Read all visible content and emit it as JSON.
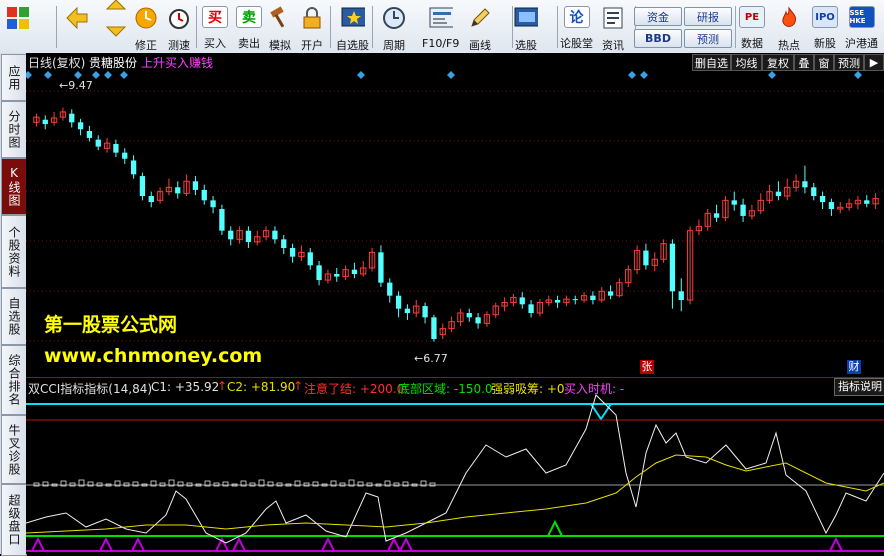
{
  "toolbar": {
    "items": [
      {
        "label": "",
        "icon": "windows-logo-icon"
      },
      {
        "label": "",
        "icon": "back-arrow-icon"
      },
      {
        "label": "",
        "icon": "up-down-arrows-icon"
      },
      {
        "label": "修正",
        "icon": "clock-refresh-icon"
      },
      {
        "label": "测速",
        "icon": "stopwatch-icon"
      },
      {
        "label": "买入",
        "icon_text": "买"
      },
      {
        "label": "卖出",
        "icon_text": "卖"
      },
      {
        "label": "模拟",
        "icon": "hammer-icon"
      },
      {
        "label": "开户",
        "icon": "lock-icon"
      },
      {
        "label": "自选股",
        "icon": "star-screen-icon"
      },
      {
        "label": "周期",
        "icon": "clock-period-icon"
      },
      {
        "label": "F10/F9",
        "icon": "document-icon"
      },
      {
        "label": "画线",
        "icon": "pencil-icon"
      },
      {
        "label": "选股",
        "icon": "screen-select-icon"
      },
      {
        "label": "论股堂",
        "icon_text": "论"
      },
      {
        "label": "资讯",
        "icon": "news-icon"
      },
      {
        "label": "数据",
        "icon_text": "PE"
      },
      {
        "label": "热点",
        "icon": "fire-icon"
      },
      {
        "label": "新股",
        "icon_text": "IPO"
      },
      {
        "label": "沪港通",
        "icon_text": "SSE HKE"
      }
    ],
    "pills": [
      "资金",
      "BBD",
      "研报",
      "预测"
    ]
  },
  "left_tabs": [
    "应用",
    "分时图",
    "K线图",
    "个股资料",
    "自选股",
    "综合排名",
    "牛叉诊股",
    "超级盘口"
  ],
  "header": {
    "period": "日线(复权)",
    "stock_name": "贵糖股份",
    "signal": "上升买入赚钱",
    "right_buttons": [
      "删自选",
      "均线",
      "复权",
      "叠",
      "窗",
      "预测"
    ],
    "right_arrow": "▶"
  },
  "price_labels": {
    "high": "←9.47",
    "low": "←6.77"
  },
  "markers": {
    "zhang": "张",
    "cai": "财"
  },
  "watermark": {
    "line1": "第一股票公式网",
    "line2": "www.chnmoney.com"
  },
  "indicator": {
    "name": "双CCI指标指标(14,84)",
    "c1": "C1: +35.92",
    "c2": "C2: +81.90",
    "warn": "注意了结: +200.0",
    "bottom": "底部区域: -150.0",
    "strong": "强弱吸筹: +0",
    "buy": "买入时机: -",
    "explain_button": "指标说明"
  },
  "colors": {
    "up": "#ff3c3c",
    "down": "#54ffff",
    "diamond": "#3aa0e0",
    "cyan_line": "#00e0ff",
    "red_line": "#c01010",
    "yellow_line": "#e8e000",
    "green_line": "#00e000",
    "purple_line": "#c000d0"
  },
  "chart_data": {
    "type": "candlestick",
    "series_note": "",
    "y_range": [
      6.5,
      9.8
    ],
    "candles": [
      [
        9.3,
        9.36,
        9.4,
        9.25
      ],
      [
        9.33,
        9.28,
        9.38,
        9.22
      ],
      [
        9.3,
        9.35,
        9.42,
        9.26
      ],
      [
        9.36,
        9.42,
        9.47,
        9.32
      ],
      [
        9.4,
        9.3,
        9.45,
        9.24
      ],
      [
        9.3,
        9.22,
        9.34,
        9.15
      ],
      [
        9.2,
        9.12,
        9.26,
        9.08
      ],
      [
        9.1,
        9.02,
        9.15,
        8.98
      ],
      [
        9.0,
        9.06,
        9.12,
        8.95
      ],
      [
        9.05,
        8.95,
        9.1,
        8.9
      ],
      [
        8.95,
        8.88,
        9.0,
        8.82
      ],
      [
        8.86,
        8.7,
        8.92,
        8.65
      ],
      [
        8.68,
        8.45,
        8.72,
        8.4
      ],
      [
        8.45,
        8.38,
        8.5,
        8.32
      ],
      [
        8.4,
        8.5,
        8.55,
        8.36
      ],
      [
        8.5,
        8.55,
        8.65,
        8.46
      ],
      [
        8.55,
        8.48,
        8.62,
        8.42
      ],
      [
        8.48,
        8.62,
        8.7,
        8.45
      ],
      [
        8.62,
        8.52,
        8.68,
        8.46
      ],
      [
        8.52,
        8.4,
        8.58,
        8.35
      ],
      [
        8.4,
        8.32,
        8.45,
        8.25
      ],
      [
        8.3,
        8.05,
        8.35,
        8.0
      ],
      [
        8.05,
        7.95,
        8.1,
        7.88
      ],
      [
        7.95,
        8.05,
        8.1,
        7.9
      ],
      [
        8.05,
        7.92,
        8.1,
        7.85
      ],
      [
        7.92,
        7.98,
        8.05,
        7.88
      ],
      [
        7.98,
        8.05,
        8.1,
        7.94
      ],
      [
        8.05,
        7.95,
        8.1,
        7.9
      ],
      [
        7.95,
        7.85,
        8.0,
        7.78
      ],
      [
        7.85,
        7.75,
        7.9,
        7.68
      ],
      [
        7.75,
        7.8,
        7.88,
        7.7
      ],
      [
        7.8,
        7.65,
        7.85,
        7.6
      ],
      [
        7.65,
        7.48,
        7.7,
        7.42
      ],
      [
        7.48,
        7.55,
        7.6,
        7.44
      ],
      [
        7.55,
        7.52,
        7.62,
        7.46
      ],
      [
        7.52,
        7.6,
        7.65,
        7.48
      ],
      [
        7.6,
        7.55,
        7.68,
        7.5
      ],
      [
        7.55,
        7.62,
        7.7,
        7.52
      ],
      [
        7.62,
        7.8,
        7.85,
        7.58
      ],
      [
        7.8,
        7.45,
        7.88,
        7.4
      ],
      [
        7.45,
        7.3,
        7.5,
        7.22
      ],
      [
        7.3,
        7.15,
        7.35,
        7.05
      ],
      [
        7.15,
        7.1,
        7.2,
        7.02
      ],
      [
        7.1,
        7.18,
        7.25,
        7.05
      ],
      [
        7.18,
        7.05,
        7.22,
        6.98
      ],
      [
        7.05,
        6.8,
        7.08,
        6.77
      ],
      [
        6.85,
        6.92,
        6.98,
        6.8
      ],
      [
        6.92,
        7.0,
        7.06,
        6.88
      ],
      [
        7.0,
        7.1,
        7.15,
        6.95
      ],
      [
        7.1,
        7.05,
        7.15,
        7.0
      ],
      [
        7.05,
        6.98,
        7.1,
        6.92
      ],
      [
        6.98,
        7.08,
        7.12,
        6.94
      ],
      [
        7.08,
        7.18,
        7.22,
        7.04
      ],
      [
        7.18,
        7.22,
        7.28,
        7.12
      ],
      [
        7.22,
        7.28,
        7.32,
        7.18
      ],
      [
        7.28,
        7.2,
        7.34,
        7.15
      ],
      [
        7.2,
        7.1,
        7.25,
        7.05
      ],
      [
        7.1,
        7.22,
        7.26,
        7.06
      ],
      [
        7.22,
        7.25,
        7.3,
        7.18
      ],
      [
        7.25,
        7.22,
        7.3,
        7.16
      ],
      [
        7.22,
        7.26,
        7.3,
        7.18
      ],
      [
        7.26,
        7.25,
        7.3,
        7.2
      ],
      [
        7.25,
        7.3,
        7.34,
        7.22
      ],
      [
        7.3,
        7.25,
        7.35,
        7.2
      ],
      [
        7.25,
        7.35,
        7.4,
        7.22
      ],
      [
        7.35,
        7.3,
        7.42,
        7.26
      ],
      [
        7.3,
        7.45,
        7.5,
        7.28
      ],
      [
        7.45,
        7.6,
        7.65,
        7.4
      ],
      [
        7.6,
        7.82,
        7.88,
        7.55
      ],
      [
        7.82,
        7.65,
        7.9,
        7.6
      ],
      [
        7.65,
        7.72,
        7.8,
        7.58
      ],
      [
        7.72,
        7.9,
        7.95,
        7.68
      ],
      [
        7.9,
        7.35,
        7.95,
        7.15
      ],
      [
        7.35,
        7.25,
        7.5,
        7.12
      ],
      [
        7.25,
        8.05,
        8.1,
        7.2
      ],
      [
        8.05,
        8.1,
        8.18,
        8.0
      ],
      [
        8.1,
        8.25,
        8.3,
        8.05
      ],
      [
        8.25,
        8.2,
        8.35,
        8.15
      ],
      [
        8.2,
        8.4,
        8.45,
        8.16
      ],
      [
        8.4,
        8.35,
        8.5,
        8.28
      ],
      [
        8.35,
        8.22,
        8.42,
        8.15
      ],
      [
        8.22,
        8.28,
        8.35,
        8.18
      ],
      [
        8.28,
        8.4,
        8.48,
        8.24
      ],
      [
        8.4,
        8.5,
        8.58,
        8.36
      ],
      [
        8.5,
        8.45,
        8.62,
        8.4
      ],
      [
        8.45,
        8.55,
        8.65,
        8.4
      ],
      [
        8.55,
        8.62,
        8.7,
        8.5
      ],
      [
        8.62,
        8.55,
        8.8,
        8.48
      ],
      [
        8.55,
        8.45,
        8.6,
        8.4
      ],
      [
        8.45,
        8.38,
        8.5,
        8.3
      ],
      [
        8.38,
        8.3,
        8.42,
        8.22
      ],
      [
        8.3,
        8.32,
        8.38,
        8.25
      ],
      [
        8.32,
        8.36,
        8.42,
        8.28
      ],
      [
        8.36,
        8.4,
        8.45,
        8.3
      ],
      [
        8.4,
        8.36,
        8.46,
        8.32
      ],
      [
        8.36,
        8.42,
        8.48,
        8.3
      ]
    ],
    "xlabel": "",
    "ylabel": ""
  }
}
